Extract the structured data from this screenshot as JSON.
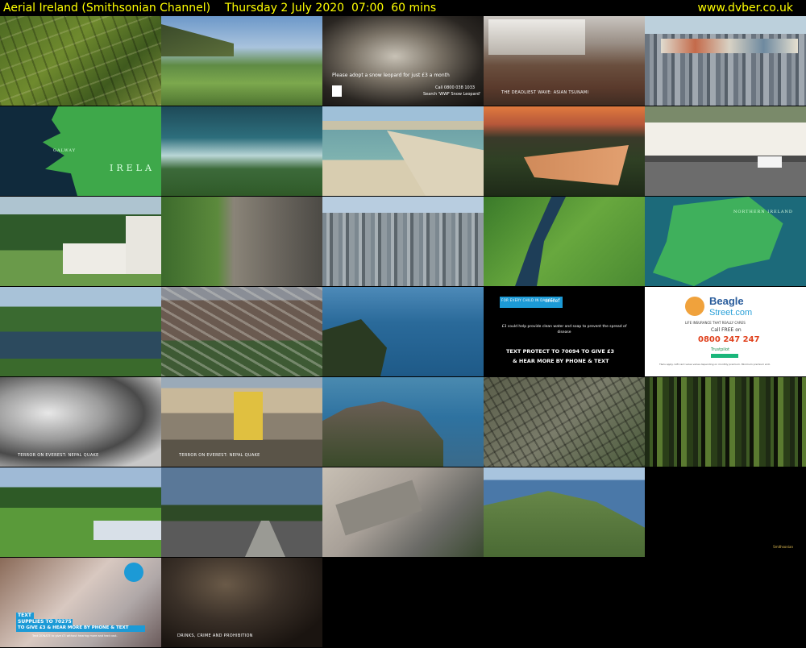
{
  "header": {
    "title": "Aerial Ireland (Smithsonian Channel)    Thursday 2 July 2020  07:00  60 mins",
    "site": "www.dvber.co.uk"
  },
  "thumbnails": {
    "t3": {
      "line1": "Please adopt a snow leopard for just £3 a month",
      "line2": "Call 0800 038 1033",
      "line3": "Search 'WWF Snow Leopard'"
    },
    "t4": {
      "caption": "THE DEADLIEST WAVE: ASIAN TSUNAMI"
    },
    "t6": {
      "word": "IRELA",
      "sub": "GALWAY"
    },
    "t15": {
      "word": "NORTHERN IRELAND"
    },
    "t19": {
      "banner": "FOR EVERY CHILD IN DANGER",
      "brand": "unicef",
      "body": "£3 could help provide clean water and soap to prevent the spread of disease",
      "cta1": "TEXT PROTECT TO 70094 TO GIVE £3",
      "cta2": "& HEAR MORE BY PHONE & TEXT"
    },
    "t20": {
      "brand1": "Beagle",
      "brand2": "Street.com",
      "tagline": "LIFE INSURANCE THAT REALLY CARES",
      "callfree": "Call FREE on",
      "phone": "0800 247 247",
      "trust": "Trustpilot",
      "fine": "T&Cs apply. Gift card value varies depending on monthly premium. Minimum premium £10."
    },
    "t21": {
      "caption": "TERROR ON EVEREST: NEPAL QUAKE"
    },
    "t22": {
      "caption": "TERROR ON EVEREST: NEPAL QUAKE"
    },
    "t31": {
      "badge": "SAVE THE CHILDREN",
      "cta1": "TEXT",
      "cta2": "SUPPLIES TO 70275",
      "cta3": "TO GIVE £3 & HEAR MORE BY PHONE & TEXT",
      "fine": "Text DONATE to give £3 without hearing more and text cost."
    },
    "t32": {
      "caption": "DRINKS, CRIME AND PROHIBITION"
    },
    "logo": "Smithsonian"
  }
}
